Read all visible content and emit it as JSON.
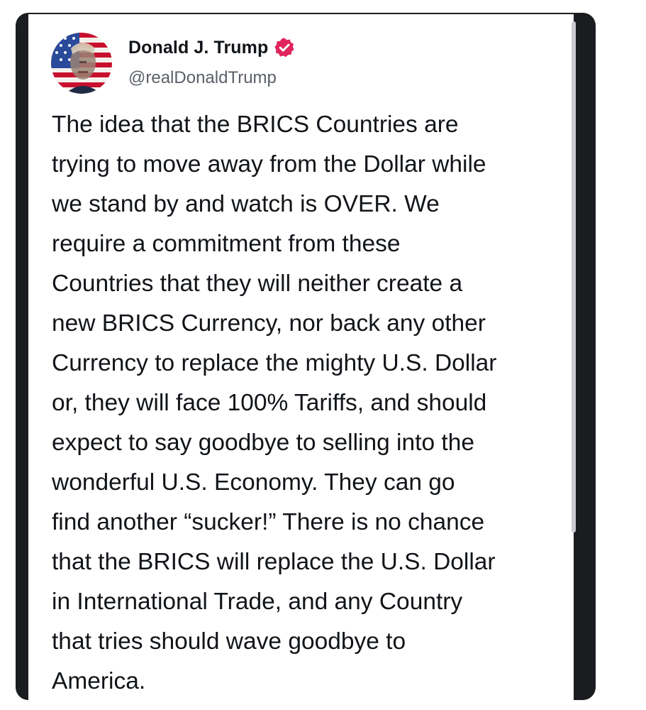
{
  "post": {
    "author": {
      "display_name": "Donald J. Trump",
      "handle": "@realDonaldTrump",
      "verified": true,
      "avatar_icon": "profile-photo-flag-portrait",
      "verified_icon": "verified-badge-icon",
      "verified_color": "#e0245e"
    },
    "lines": [
      "The idea that the BRICS Countries are",
      "trying to move away from the Dollar while",
      "we stand by and watch is OVER. We",
      "require a commitment from these",
      "Countries that they will neither create a",
      "new BRICS Currency, nor back any other",
      "Currency to replace the mighty U.S. Dollar",
      "or, they will face 100% Tariffs, and should",
      "expect to say goodbye to selling into the",
      "wonderful U.S. Economy. They can go",
      "find another “sucker!” There is no chance",
      "that the BRICS will replace the U.S. Dollar",
      "in International Trade, and any Country",
      "that tries should wave goodbye to",
      "America."
    ]
  },
  "colors": {
    "frame": "#1a1c20",
    "text": "#111418",
    "handle": "#5b6068",
    "scrollbar": "#c9cbcf"
  }
}
